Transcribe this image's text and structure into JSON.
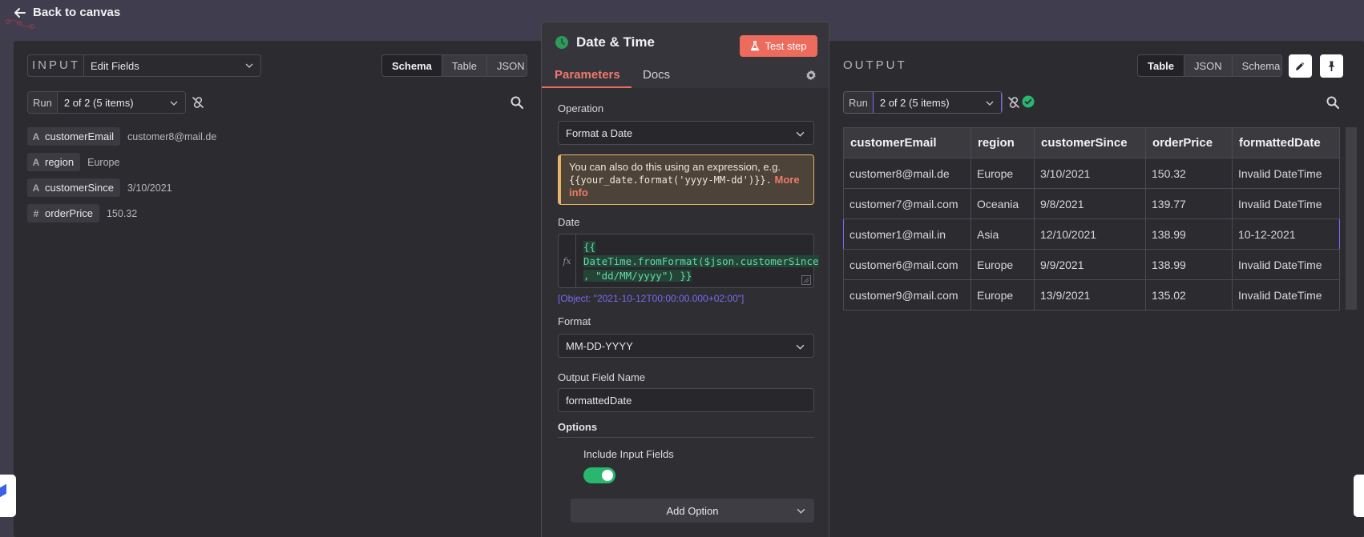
{
  "topbar": {
    "back_label": "Back to canvas"
  },
  "input": {
    "title": "INPUT",
    "node_select": "Edit Fields",
    "views": [
      "Schema",
      "Table",
      "JSON"
    ],
    "active_view": "Schema",
    "run_label": "Run",
    "run_select": "2 of 2 (5 items)",
    "schema": [
      {
        "type": "A",
        "key": "customerEmail",
        "value": "customer8@mail.de"
      },
      {
        "type": "A",
        "key": "region",
        "value": "Europe"
      },
      {
        "type": "A",
        "key": "customerSince",
        "value": "3/10/2021"
      },
      {
        "type": "#",
        "key": "orderPrice",
        "value": "150.32"
      }
    ]
  },
  "node": {
    "title": "Date & Time",
    "test_button": "Test step",
    "tabs": [
      "Parameters",
      "Docs"
    ],
    "active_tab": "Parameters",
    "operation_label": "Operation",
    "operation_value": "Format a Date",
    "notice_text": "You can also do this using an expression, e.g.",
    "notice_code": "{{your_date.format('yyyy-MM-dd')}}.",
    "notice_link": "More info",
    "date_label": "Date",
    "date_expression_lines": [
      "{{",
      "DateTime.fromFormat($json.customerSince",
      ", \"dd/MM/yyyy\") }}"
    ],
    "fx_label": "fx",
    "date_result": "[Object: \"2021-10-12T00:00:00.000+02:00\"]",
    "format_label": "Format",
    "format_value": "MM-DD-YYYY",
    "output_field_label": "Output Field Name",
    "output_field_value": "formattedDate",
    "options_title": "Options",
    "include_input_label": "Include Input Fields",
    "include_input_on": true,
    "add_option": "Add Option"
  },
  "output": {
    "title": "OUTPUT",
    "views": [
      "Table",
      "JSON",
      "Schema"
    ],
    "active_view": "Table",
    "run_label": "Run",
    "run_select": "2 of 2 (5 items)",
    "columns": [
      "customerEmail",
      "region",
      "customerSince",
      "orderPrice",
      "formattedDate"
    ],
    "rows": [
      [
        "customer8@mail.de",
        "Europe",
        "3/10/2021",
        "150.32",
        "Invalid DateTime"
      ],
      [
        "customer7@mail.com",
        "Oceania",
        "9/8/2021",
        "139.77",
        "Invalid DateTime"
      ],
      [
        "customer1@mail.in",
        "Asia",
        "12/10/2021",
        "138.99",
        "10-12-2021"
      ],
      [
        "customer6@mail.com",
        "Europe",
        "9/9/2021",
        "138.99",
        "Invalid DateTime"
      ],
      [
        "customer9@mail.com",
        "Europe",
        "13/9/2021",
        "135.02",
        "Invalid DateTime"
      ]
    ],
    "highlighted_row": 2
  },
  "colors": {
    "accent": "#ec6b5c",
    "success": "#29b66e",
    "link": "#7a6bf2",
    "warning": "#e5b46a"
  }
}
